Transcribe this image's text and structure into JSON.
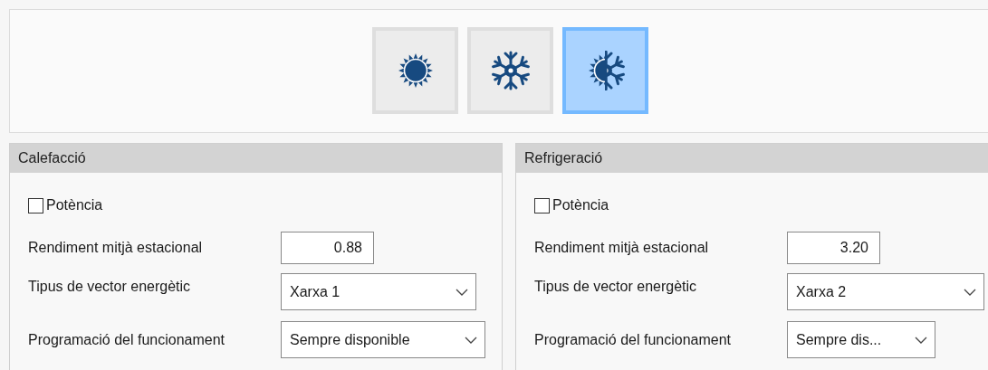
{
  "mode_buttons": [
    {
      "kind": "heating",
      "selected": false
    },
    {
      "kind": "cooling",
      "selected": false
    },
    {
      "kind": "both",
      "selected": true
    }
  ],
  "groups": [
    {
      "title": "Calefacció",
      "power": {
        "label": "Potència",
        "checked": false
      },
      "fields": [
        {
          "kind": "input",
          "label": "Rendiment mitjà estacional",
          "value": "0.88"
        },
        {
          "kind": "select",
          "label": "Tipus de vector energètic",
          "value": "Xarxa 1"
        },
        {
          "kind": "select",
          "label": "Programació del funcionament",
          "value": "Sempre disponible"
        }
      ]
    },
    {
      "title": "Refrigeració",
      "power": {
        "label": "Potència",
        "checked": false
      },
      "fields": [
        {
          "kind": "input",
          "label": "Rendiment mitjà estacional",
          "value": "3.20"
        },
        {
          "kind": "select",
          "label": "Tipus de vector energètic",
          "value": "Xarxa 2"
        },
        {
          "kind": "select",
          "label": "Programació del funcionament",
          "value": "Sempre dis..."
        }
      ]
    }
  ]
}
